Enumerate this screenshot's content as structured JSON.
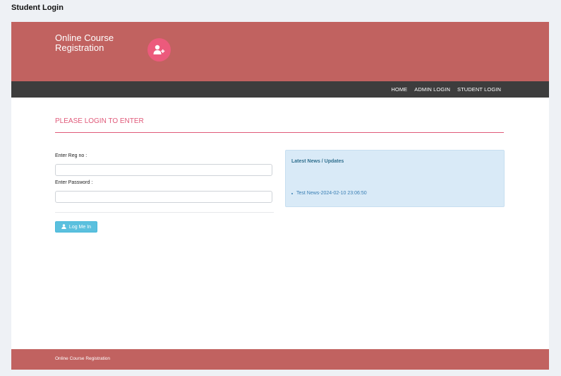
{
  "page": {
    "title": "Student Login"
  },
  "header": {
    "brand_line1": "Online Course",
    "brand_line2": "Registration",
    "icon": "add-user-icon",
    "color": "#c16260",
    "icon_color": "#ec5a7c"
  },
  "nav": {
    "items": [
      {
        "label": "HOME"
      },
      {
        "label": "ADMIN LOGIN"
      },
      {
        "label": "STUDENT LOGIN"
      }
    ]
  },
  "main": {
    "heading": "PLEASE LOGIN TO ENTER",
    "form": {
      "reg_label": "Enter Reg no :",
      "reg_value": "",
      "password_label": "Enter Password :",
      "password_value": "",
      "button_label": "Log Me In",
      "button_icon": "user-icon"
    },
    "news": {
      "title": "Latest News / Updates",
      "items": [
        {
          "text": "Test News-2024-02-10 23:06:50"
        }
      ]
    }
  },
  "footer": {
    "text": "Online Course Registration"
  }
}
